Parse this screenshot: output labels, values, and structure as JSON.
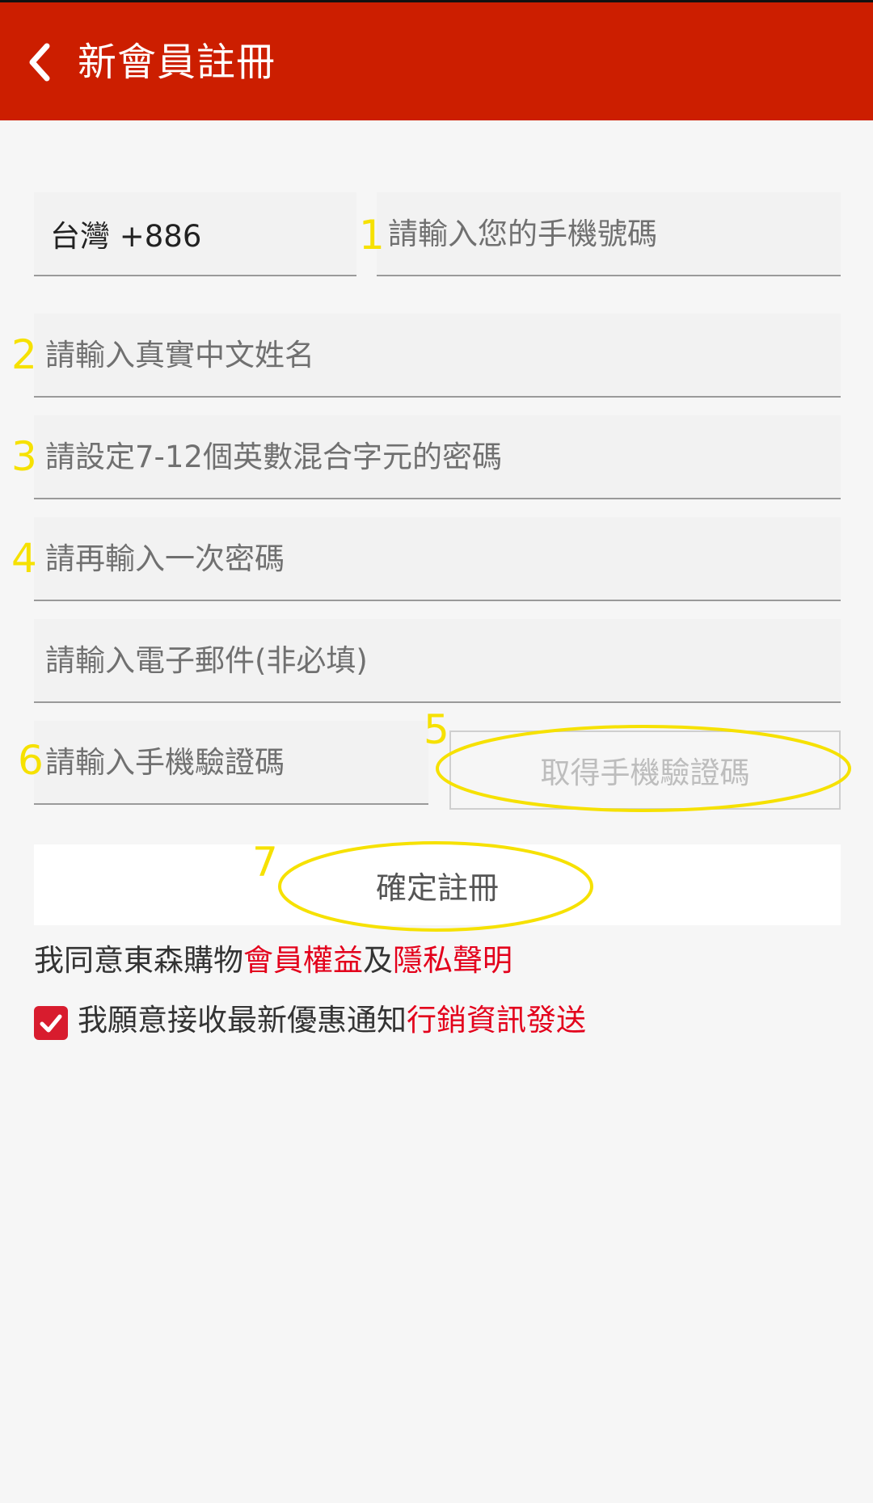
{
  "header": {
    "title": "新會員註冊",
    "back_icon": "chevron-left-icon",
    "background_color": "#cc1e00"
  },
  "form": {
    "country_code": "台灣 +886",
    "phone_placeholder": "請輸入您的手機號碼",
    "name_placeholder": "請輸入真實中文姓名",
    "password_placeholder": "請設定7-12個英數混合字元的密碼",
    "confirm_password_placeholder": "請再輸入一次密碼",
    "email_placeholder": "請輸入電子郵件(非必填)",
    "otp_placeholder": "請輸入手機驗證碼",
    "get_otp_label": "取得手機驗證碼",
    "submit_label": "確定註冊"
  },
  "annotations": {
    "n1": "1",
    "n2": "2",
    "n3": "3",
    "n4": "4",
    "n5": "5",
    "n6": "6",
    "n7": "7",
    "color": "#f6e100"
  },
  "terms": {
    "prefix": "我同意東森購物",
    "link1": "會員權益",
    "joiner": "及",
    "link2": "隱私聲明"
  },
  "marketing": {
    "checked": true,
    "text": "我願意接收最新優惠通知",
    "link": "行銷資訊發送"
  },
  "colors": {
    "accent_red": "#e3001b",
    "checkbox": "#d81c2e"
  }
}
